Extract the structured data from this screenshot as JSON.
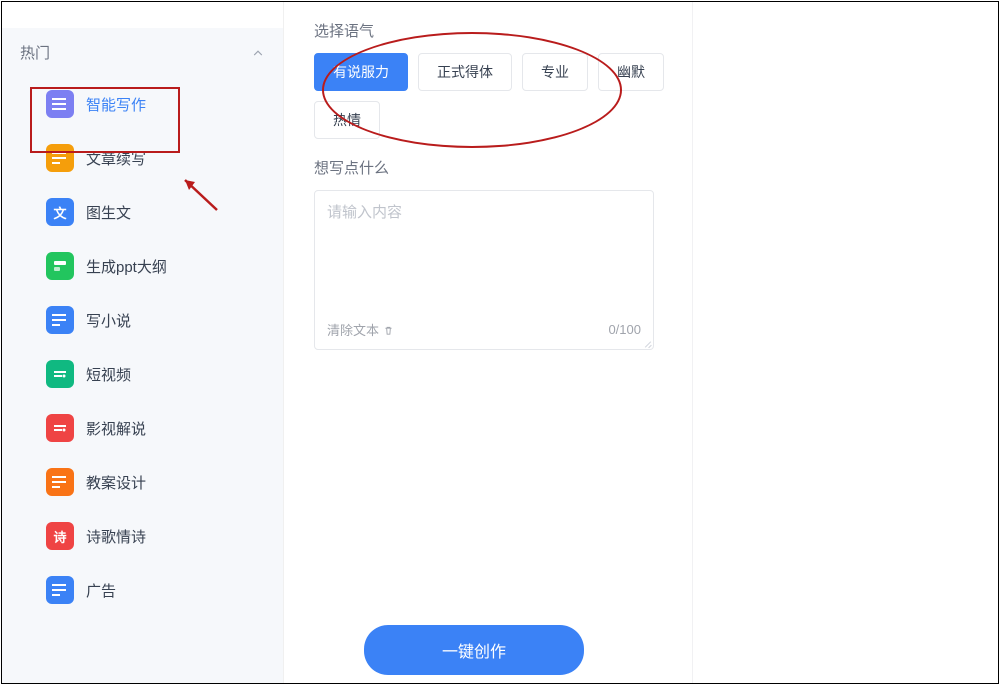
{
  "sidebar": {
    "section_title": "热门",
    "items": [
      {
        "label": "智能写作",
        "icon_color": "icon-purple"
      },
      {
        "label": "文章续写",
        "icon_color": "icon-orange"
      },
      {
        "label": "图生文",
        "icon_color": "icon-blue",
        "icon_text": "文"
      },
      {
        "label": "生成ppt大纲",
        "icon_color": "icon-green"
      },
      {
        "label": "写小说",
        "icon_color": "icon-blue"
      },
      {
        "label": "短视频",
        "icon_color": "icon-green2"
      },
      {
        "label": "影视解说",
        "icon_color": "icon-red"
      },
      {
        "label": "教案设计",
        "icon_color": "icon-orange2"
      },
      {
        "label": "诗歌情诗",
        "icon_color": "icon-red2",
        "icon_text": "诗"
      },
      {
        "label": "广告",
        "icon_color": "icon-blue"
      }
    ]
  },
  "content": {
    "tone_label": "选择语气",
    "tones": [
      {
        "label": "有说服力",
        "selected": true
      },
      {
        "label": "正式得体",
        "selected": false
      },
      {
        "label": "专业",
        "selected": false
      },
      {
        "label": "幽默",
        "selected": false
      },
      {
        "label": "热情",
        "selected": false
      }
    ],
    "prompt_label": "想写点什么",
    "textarea_placeholder": "请输入内容",
    "clear_label": "清除文本",
    "char_count": "0/100",
    "submit_label": "一键创作"
  }
}
